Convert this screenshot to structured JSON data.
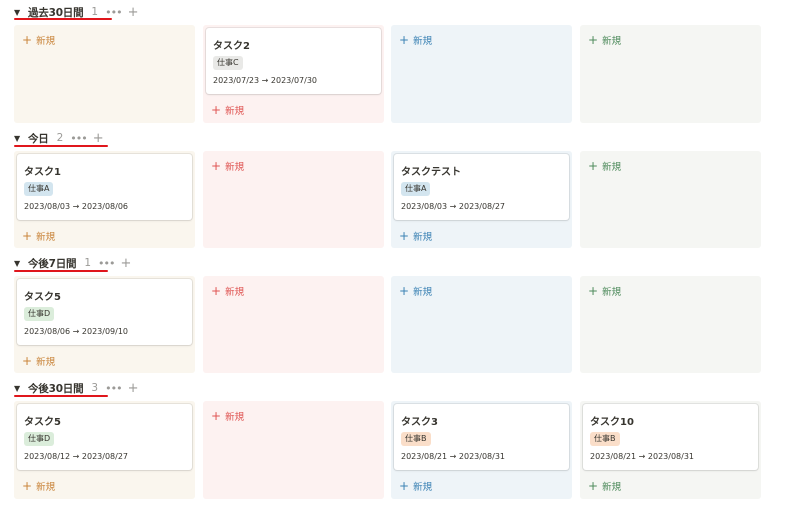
{
  "new_label": "新規",
  "groups": [
    {
      "title": "過去30日間",
      "count": "1",
      "card0": null,
      "card1": {
        "title": "タスク2",
        "tag": "仕事C",
        "tag_color": "#e9e9e7",
        "dates": "2023/07/23 → 2023/07/30"
      },
      "card2": null,
      "card3": null
    },
    {
      "title": "今日",
      "count": "2",
      "card0": {
        "title": "タスク1",
        "tag": "仕事A",
        "tag_color": "#d3e5ef",
        "dates": "2023/08/03 → 2023/08/06"
      },
      "card1": null,
      "card2": {
        "title": "タスクテスト",
        "tag": "仕事A",
        "tag_color": "#d3e5ef",
        "dates": "2023/08/03 → 2023/08/27"
      },
      "card3": null
    },
    {
      "title": "今後7日間",
      "count": "1",
      "card0": {
        "title": "タスク5",
        "tag": "仕事D",
        "tag_color": "#dbeddb",
        "dates": "2023/08/06 → 2023/09/10"
      },
      "card1": null,
      "card2": null,
      "card3": null
    },
    {
      "title": "今後30日間",
      "count": "3",
      "card0": {
        "title": "タスク5",
        "tag": "仕事D",
        "tag_color": "#dbeddb",
        "dates": "2023/08/12 → 2023/08/27"
      },
      "card1": null,
      "card2": {
        "title": "タスク3",
        "tag": "仕事B",
        "tag_color": "#fadec9",
        "dates": "2023/08/21 → 2023/08/31"
      },
      "card3": {
        "title": "タスク10",
        "tag": "仕事B",
        "tag_color": "#fadec9",
        "dates": "2023/08/21 → 2023/08/31"
      }
    }
  ],
  "accent_underline": "#e0161c",
  "icons": {
    "caret": "triangle-down-icon",
    "more": "more-icon",
    "add": "plus-icon"
  }
}
